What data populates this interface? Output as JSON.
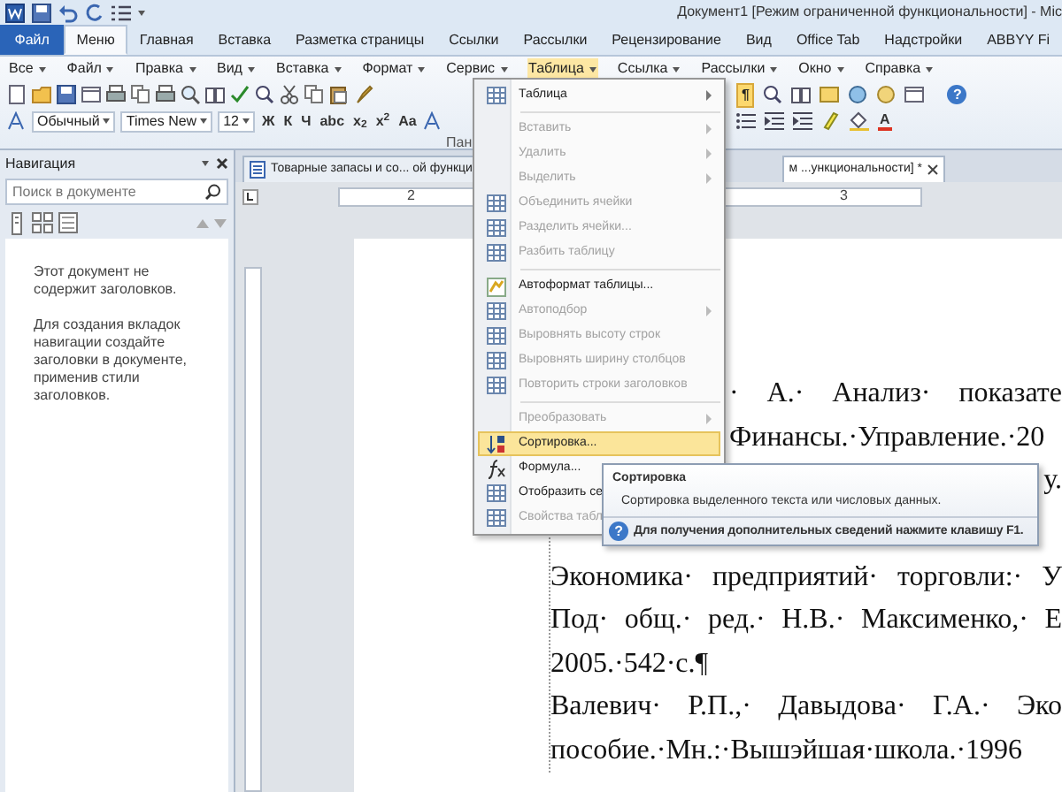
{
  "title_bar": {
    "title": "Документ1 [Режим ограниченной функциональности] - Mic"
  },
  "ribbon_tabs": [
    {
      "label": "Файл",
      "kind": "file",
      "selected": false
    },
    {
      "label": "Меню",
      "kind": "tab",
      "selected": true
    },
    {
      "label": "Главная",
      "kind": "tab",
      "selected": false
    },
    {
      "label": "Вставка",
      "kind": "tab",
      "selected": false
    },
    {
      "label": "Разметка страницы",
      "kind": "tab",
      "selected": false
    },
    {
      "label": "Ссылки",
      "kind": "tab",
      "selected": false
    },
    {
      "label": "Рассылки",
      "kind": "tab",
      "selected": false
    },
    {
      "label": "Рецензирование",
      "kind": "tab",
      "selected": false
    },
    {
      "label": "Вид",
      "kind": "tab",
      "selected": false
    },
    {
      "label": "Office Tab",
      "kind": "tab",
      "selected": false
    },
    {
      "label": "Надстройки",
      "kind": "tab",
      "selected": false
    },
    {
      "label": "ABBYY Fi",
      "kind": "tab",
      "selected": false
    }
  ],
  "menu_bar": [
    {
      "label": "Все",
      "selected": false
    },
    {
      "label": "Файл",
      "selected": false
    },
    {
      "label": "Правка",
      "selected": false
    },
    {
      "label": "Вид",
      "selected": false
    },
    {
      "label": "Вставка",
      "selected": false
    },
    {
      "label": "Формат",
      "selected": false
    },
    {
      "label": "Сервис",
      "selected": false
    },
    {
      "label": "Таблица",
      "selected": true
    },
    {
      "label": "Ссылка",
      "selected": false
    },
    {
      "label": "Рассылки",
      "selected": false
    },
    {
      "label": "Окно",
      "selected": false
    },
    {
      "label": "Справка",
      "selected": false
    }
  ],
  "toolbar": {
    "style": "Обычный",
    "font": "Times New",
    "size": "12",
    "format_buttons": [
      "Ж",
      "К",
      "Ч",
      "abc",
      "x$_{2}$",
      "x$^{2}$",
      "Aa"
    ],
    "group_label": "Пан",
    "pilcrow": {
      "label": "¶",
      "selected": true
    },
    "font_color": "A",
    "help_glyph": "?"
  },
  "navigation": {
    "title": "Навигация",
    "search_placeholder": "Поиск в документе",
    "message": "Этот документ не содержит заголовков.",
    "hint": "Для создания вкладок навигации создайте заголовки в документе, применив стили заголовков."
  },
  "document_tabs": [
    {
      "label": "Товарные запасы и со... ой функци",
      "selected": false
    },
    {
      "label": "м ...ункциональности] *",
      "selected": true
    }
  ],
  "ruler_labels": [
    "2",
    "3"
  ],
  "table_menu": [
    {
      "kind": "grid",
      "label": "Таблица",
      "disabled": false,
      "submenu": true,
      "selected": false
    },
    {
      "kind": "separator"
    },
    {
      "kind": "plain",
      "label": "Вставить",
      "disabled": true,
      "submenu": true,
      "selected": false
    },
    {
      "kind": "plain",
      "label": "Удалить",
      "disabled": true,
      "submenu": true,
      "selected": false
    },
    {
      "kind": "plain",
      "label": "Выделить",
      "disabled": true,
      "submenu": true,
      "selected": false
    },
    {
      "kind": "grid",
      "label": "Объединить ячейки",
      "disabled": true,
      "submenu": false,
      "selected": false
    },
    {
      "kind": "grid",
      "label": "Разделить ячейки...",
      "disabled": true,
      "submenu": false,
      "selected": false
    },
    {
      "kind": "grid",
      "label": "Разбить таблицу",
      "disabled": true,
      "submenu": false,
      "selected": false
    },
    {
      "kind": "separator"
    },
    {
      "kind": "palette",
      "label": "Автоформат таблицы...",
      "disabled": false,
      "submenu": false,
      "selected": false
    },
    {
      "kind": "grid",
      "label": "Автоподбор",
      "disabled": true,
      "submenu": true,
      "selected": false
    },
    {
      "kind": "grid",
      "label": "Выровнять высоту строк",
      "disabled": true,
      "submenu": false,
      "selected": false
    },
    {
      "kind": "grid",
      "label": "Выровнять ширину столбцов",
      "disabled": true,
      "submenu": false,
      "selected": false
    },
    {
      "kind": "grid",
      "label": "Повторить строки заголовков",
      "disabled": true,
      "submenu": false,
      "selected": false
    },
    {
      "kind": "separator"
    },
    {
      "kind": "plain",
      "label": "Преобразовать",
      "disabled": true,
      "submenu": true,
      "selected": false
    },
    {
      "kind": "sort",
      "label": "Сортировка...",
      "disabled": false,
      "submenu": false,
      "selected": true
    },
    {
      "kind": "formula",
      "label": "Формула...",
      "disabled": false,
      "submenu": false,
      "selected": false
    },
    {
      "kind": "grid",
      "label": "Отобразить се",
      "disabled": false,
      "submenu": false,
      "selected": false
    },
    {
      "kind": "grid",
      "label": "Свойства табл",
      "disabled": true,
      "submenu": false,
      "selected": false
    }
  ],
  "tooltip": {
    "title": "Сортировка",
    "text": "Сортировка выделенного текста или числовых данных.",
    "help": "Для получения дополнительных сведений нажмите клавишу F1.",
    "help_glyph": "?"
  },
  "document_lines": [
    {
      "kind": "covered",
      "text": "· А.· Анализ· показате"
    },
    {
      "kind": "covered",
      "text": "Финансы.·Управление.·20"
    },
    {
      "kind": "tail",
      "text": "у."
    },
    {
      "kind": "full",
      "text": "Экономика· предприятий· торговли:· У"
    },
    {
      "kind": "full",
      "text": "Под· общ.· ред.· Н.В.· Максименко,· Е"
    },
    {
      "kind": "short",
      "text": "2005.·542·с.¶"
    },
    {
      "kind": "full",
      "text": "Валевич· Р.П.,· Давыдова· Г.А.· Эко"
    },
    {
      "kind": "full",
      "text": "пособие.·Мн.:·Вышэйшая·школа.·1996"
    }
  ]
}
